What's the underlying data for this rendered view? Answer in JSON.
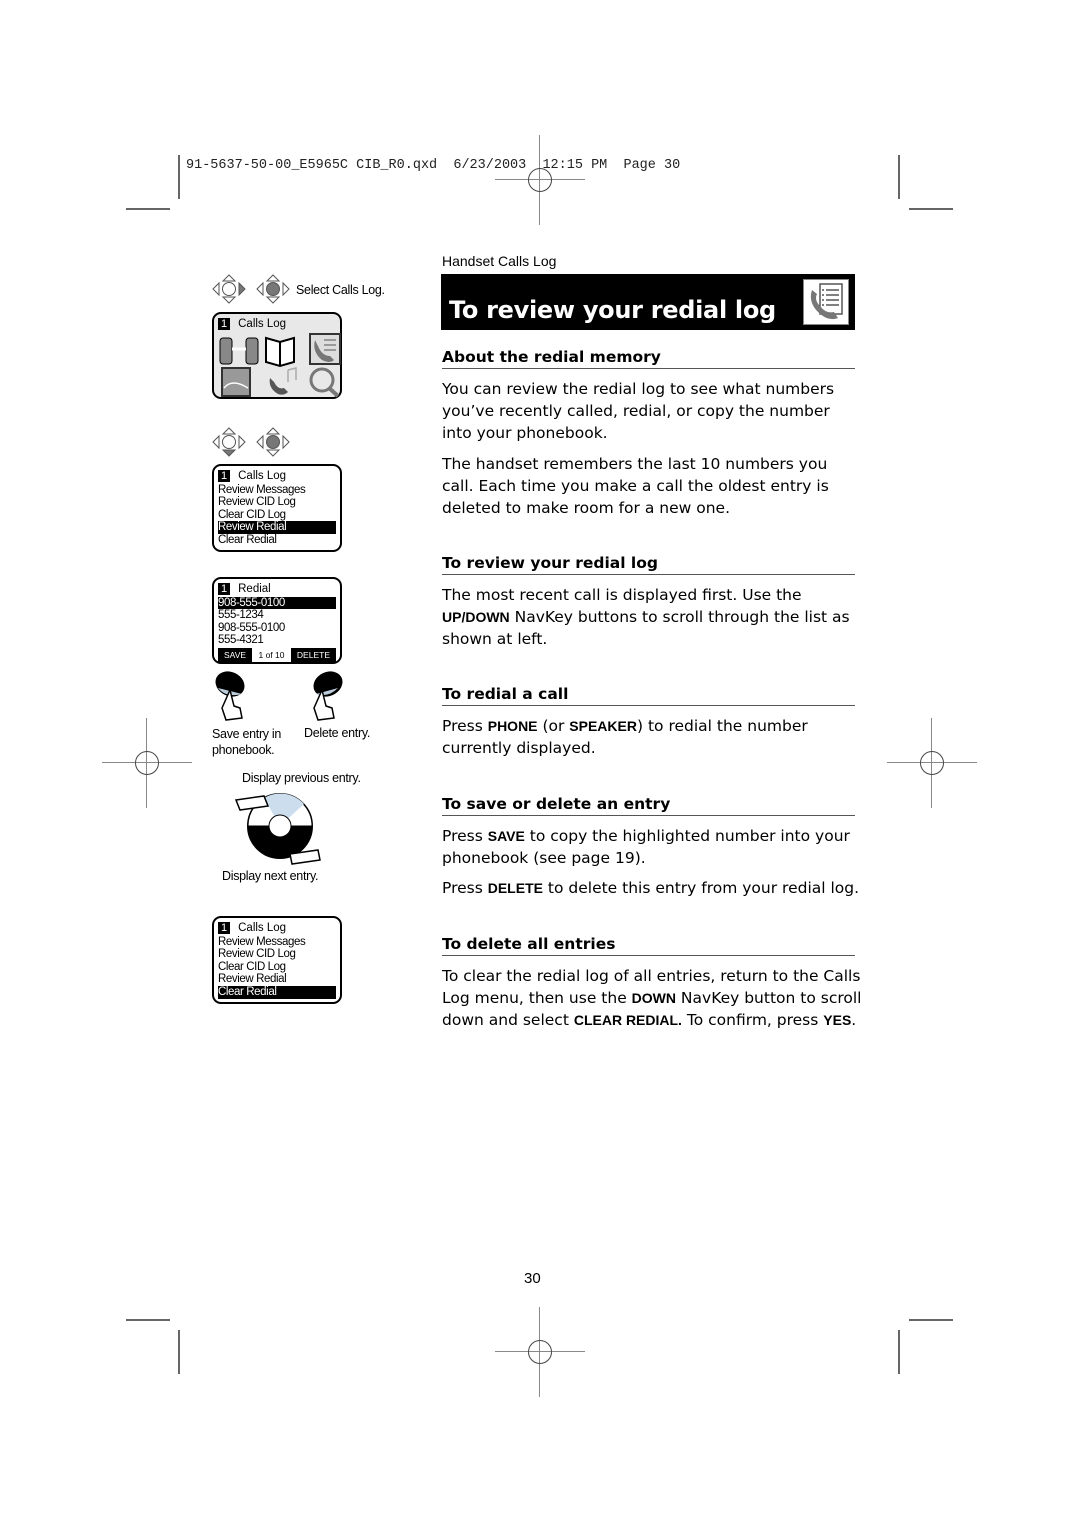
{
  "print_slug": "91-5637-50-00_E5965C CIB_R0.qxd  6/23/2003  12:15 PM  Page 30",
  "header": {
    "section_label": "Handset Calls Log",
    "title": "To review your redial log",
    "title_icon": "calls-log-icon"
  },
  "sidebar": {
    "step1_caption": "Select Calls Log.",
    "screen1": {
      "num": "1",
      "title": "Calls Log",
      "icons": [
        "intercom-icon",
        "phonebook-icon",
        "calls-log-icon",
        "picture-icon",
        "ringer-icon",
        "settings-icon"
      ]
    },
    "screen2": {
      "num": "1",
      "title": "Calls Log",
      "items": [
        "Review Messages",
        "Review CID Log",
        "Clear CID Log",
        "Review Redial",
        "Clear Redial"
      ],
      "selected_index": 3
    },
    "screen3": {
      "num": "1",
      "title": "Redial",
      "items": [
        "908-555-0100",
        "555-1234",
        "908-555-0100",
        "555-4321"
      ],
      "selected_index": 0,
      "softkey_left": "SAVE",
      "counter": "1 of 10",
      "softkey_right": "DELETE"
    },
    "save_caption": "Save entry in phonebook.",
    "delete_caption": "Delete entry.",
    "prev_caption": "Display previous entry.",
    "next_caption": "Display next entry.",
    "screen4": {
      "num": "1",
      "title": "Calls Log",
      "items": [
        "Review Messages",
        "Review CID Log",
        "Clear CID Log",
        "Review Redial",
        "Clear Redial"
      ],
      "selected_index": 4
    }
  },
  "sections": {
    "about": {
      "heading": "About the redial memory",
      "p1": "You can review the redial log to see what numbers you’ve recently called, redial, or copy the number into your phonebook.",
      "p2": "The handset remembers the last 10 numbers you call. Each time you make a call the oldest entry is deleted to make room for a new one."
    },
    "review": {
      "heading": "To review your redial log",
      "p1a": "The most recent call is displayed first. Use the ",
      "p1b": "UP/DOWN",
      "p1c": " NavKey buttons to scroll through the list as shown at left."
    },
    "redial": {
      "heading": "To redial a call",
      "a": "Press ",
      "b": "PHONE",
      "c": " (or ",
      "d": "SPEAKER",
      "e": ") to redial the number currently displayed."
    },
    "save_delete": {
      "heading": "To save or delete an entry",
      "p1a": "Press ",
      "p1b": "SAVE",
      "p1c": " to copy the highlighted number into your phonebook (see page 19).",
      "p2a": "Press ",
      "p2b": "DELETE",
      "p2c": " to delete this entry from your redial log."
    },
    "delete_all": {
      "heading": "To delete all entries",
      "a": "To clear the redial log of all entries, return to the Calls Log menu, then use the ",
      "b": "DOWN",
      "c": " NavKey button to scroll down and select ",
      "d": "CLEAR REDIAL.",
      "e": " To confirm, press ",
      "f": "YES",
      "g": "."
    }
  },
  "page_number": "30"
}
